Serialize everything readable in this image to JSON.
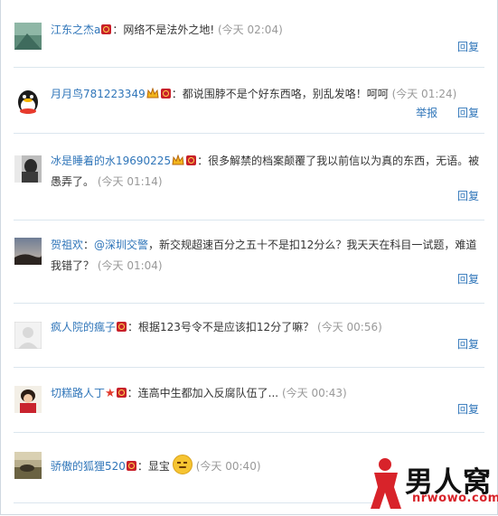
{
  "comments": [
    {
      "user": "江东之杰a",
      "text": "：网络不是法外之地!",
      "time": "(今天 02:04)",
      "reply": "回复",
      "report": ""
    },
    {
      "user": "月月鸟781223349",
      "text": "：都说围脖不是个好东西咯，别乱发咯！呵呵",
      "time": "(今天 01:24)",
      "reply": "回复",
      "report": "举报"
    },
    {
      "user": "冰是睡着的水19690225",
      "text": "：很多解禁的档案颠覆了我以前信以为真的东西，无语。被愚弄了。",
      "time": "(今天 01:14)",
      "reply": "回复",
      "report": ""
    },
    {
      "user": "贺祖欢",
      "mention": "@深圳交警",
      "text_before": "：",
      "text": "，新交规超速百分之五十不是扣12分么？我天天在科目一试题，难道我错了？",
      "time": "(今天 01:04)",
      "reply": "回复",
      "report": ""
    },
    {
      "user": "疯人院的瘋子",
      "text": "：根据123号令不是应该扣12分了嘛？",
      "time": "(今天 00:56)",
      "reply": "回复",
      "report": ""
    },
    {
      "user": "切糕路人丁",
      "text": "：连高中生都加入反腐队伍了...",
      "time": "(今天 00:43)",
      "reply": "回复",
      "report": ""
    },
    {
      "user": "骄傲的狐狸520",
      "text": "：显宝",
      "time": "(今天 00:40)",
      "reply": "",
      "report": ""
    }
  ],
  "watermark": {
    "text": "男人窝",
    "url": "nrwowo.com"
  },
  "colors": {
    "link": "#2f75b9",
    "time": "#999999",
    "separator": "#dbe6ee",
    "badge": "#c8202a",
    "logo_red": "#d8232a"
  },
  "icons": [
    "vip-badge-icon",
    "crown-icon",
    "star-icon",
    "smile-emoji-icon"
  ]
}
